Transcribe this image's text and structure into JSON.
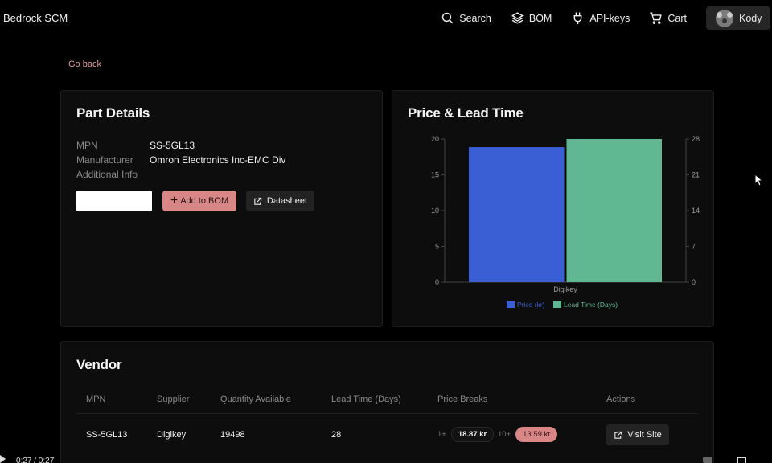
{
  "app": {
    "title": "Bedrock SCM"
  },
  "nav": {
    "search": "Search",
    "bom": "BOM",
    "api_keys": "API-keys",
    "cart": "Cart",
    "user": "Kody"
  },
  "go_back": "Go back",
  "part": {
    "title": "Part Details",
    "mpn_label": "MPN",
    "mpn": "SS-5GL13",
    "manufacturer_label": "Manufacturer",
    "manufacturer": "Omron Electronics Inc-EMC Div",
    "additional_label": "Additional Info",
    "additional": "",
    "quantity_value": "",
    "add_label": "Add to BOM",
    "datasheet_label": "Datasheet"
  },
  "chart_card": {
    "title": "Price & Lead Time"
  },
  "chart_data": {
    "type": "bar",
    "categories": [
      "Digikey"
    ],
    "series": [
      {
        "name": "Price (kr)",
        "values": [
          18.87
        ],
        "axis": "left",
        "color": "#3a5fd4"
      },
      {
        "name": "Lead Time (Days)",
        "values": [
          28
        ],
        "axis": "right",
        "color": "#5fb891"
      }
    ],
    "y_left": {
      "ticks": [
        0,
        5,
        10,
        15,
        20
      ],
      "ylim": [
        0,
        20
      ]
    },
    "y_right": {
      "ticks": [
        0,
        7,
        14,
        21,
        28
      ],
      "ylim": [
        0,
        28
      ]
    },
    "legend": "bottom"
  },
  "vendor": {
    "title": "Vendor",
    "columns": [
      "MPN",
      "Supplier",
      "Quantity Available",
      "Lead Time (Days)",
      "Price Breaks",
      "Actions"
    ],
    "rows": [
      {
        "mpn": "SS-5GL13",
        "supplier": "Digikey",
        "quantity": "19498",
        "lead_time": "28",
        "price_breaks": [
          {
            "qty": "1+",
            "price": "18.87 kr"
          },
          {
            "qty": "10+",
            "price": "13.59 kr"
          }
        ],
        "action": "Visit Site"
      }
    ]
  },
  "video": {
    "time": "0:27 / 0:27"
  },
  "colors": {
    "accent": "#d98686",
    "price_series": "#3a5fd4",
    "lead_series": "#5fb891"
  }
}
